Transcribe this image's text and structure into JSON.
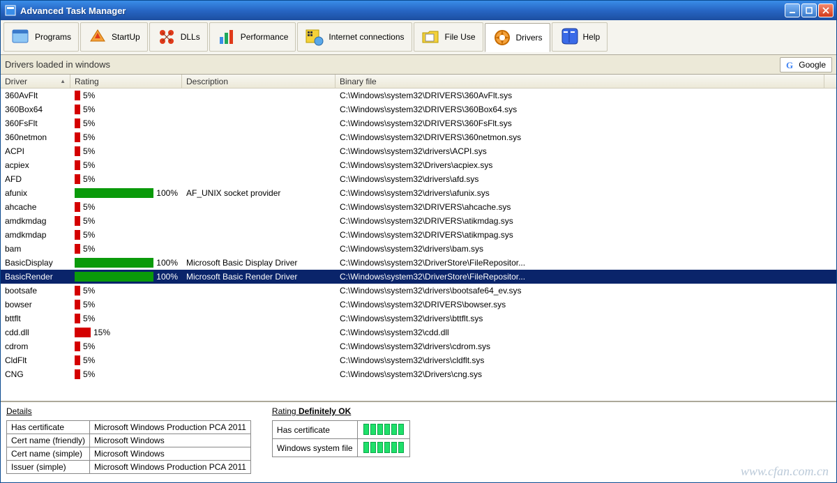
{
  "window": {
    "title": "Advanced Task Manager"
  },
  "tabs": [
    {
      "label": "Programs"
    },
    {
      "label": "StartUp"
    },
    {
      "label": "DLLs"
    },
    {
      "label": "Performance"
    },
    {
      "label": "Internet connections"
    },
    {
      "label": "File Use"
    },
    {
      "label": "Drivers"
    },
    {
      "label": "Help"
    }
  ],
  "subbar": {
    "title": "Drivers loaded in windows",
    "google_label": "Google"
  },
  "columns": {
    "driver": "Driver",
    "rating": "Rating",
    "description": "Description",
    "binary": "Binary file"
  },
  "rows": [
    {
      "driver": "360AvFlt",
      "rating": 5,
      "color": "red",
      "description": "",
      "binary": "C:\\Windows\\system32\\DRIVERS\\360AvFlt.sys"
    },
    {
      "driver": "360Box64",
      "rating": 5,
      "color": "red",
      "description": "",
      "binary": "C:\\Windows\\system32\\DRIVERS\\360Box64.sys"
    },
    {
      "driver": "360FsFlt",
      "rating": 5,
      "color": "red",
      "description": "",
      "binary": "C:\\Windows\\system32\\DRIVERS\\360FsFlt.sys"
    },
    {
      "driver": "360netmon",
      "rating": 5,
      "color": "red",
      "description": "",
      "binary": "C:\\Windows\\system32\\DRIVERS\\360netmon.sys"
    },
    {
      "driver": "ACPI",
      "rating": 5,
      "color": "red",
      "description": "",
      "binary": "C:\\Windows\\system32\\drivers\\ACPI.sys"
    },
    {
      "driver": "acpiex",
      "rating": 5,
      "color": "red",
      "description": "",
      "binary": "C:\\Windows\\system32\\Drivers\\acpiex.sys"
    },
    {
      "driver": "AFD",
      "rating": 5,
      "color": "red",
      "description": "",
      "binary": "C:\\Windows\\system32\\drivers\\afd.sys"
    },
    {
      "driver": "afunix",
      "rating": 100,
      "color": "green",
      "description": "AF_UNIX socket provider",
      "binary": "C:\\Windows\\system32\\drivers\\afunix.sys"
    },
    {
      "driver": "ahcache",
      "rating": 5,
      "color": "red",
      "description": "",
      "binary": "C:\\Windows\\system32\\DRIVERS\\ahcache.sys"
    },
    {
      "driver": "amdkmdag",
      "rating": 5,
      "color": "red",
      "description": "",
      "binary": "C:\\Windows\\system32\\DRIVERS\\atikmdag.sys"
    },
    {
      "driver": "amdkmdap",
      "rating": 5,
      "color": "red",
      "description": "",
      "binary": "C:\\Windows\\system32\\DRIVERS\\atikmpag.sys"
    },
    {
      "driver": "bam",
      "rating": 5,
      "color": "red",
      "description": "",
      "binary": "C:\\Windows\\system32\\drivers\\bam.sys"
    },
    {
      "driver": "BasicDisplay",
      "rating": 100,
      "color": "green",
      "description": "Microsoft Basic Display Driver",
      "binary": "C:\\Windows\\system32\\DriverStore\\FileRepositor..."
    },
    {
      "driver": "BasicRender",
      "rating": 100,
      "color": "green",
      "description": "Microsoft Basic Render Driver",
      "binary": "C:\\Windows\\system32\\DriverStore\\FileRepositor...",
      "selected": true
    },
    {
      "driver": "bootsafe",
      "rating": 5,
      "color": "red",
      "description": "",
      "binary": "C:\\Windows\\system32\\drivers\\bootsafe64_ev.sys"
    },
    {
      "driver": "bowser",
      "rating": 5,
      "color": "red",
      "description": "",
      "binary": "C:\\Windows\\system32\\DRIVERS\\bowser.sys"
    },
    {
      "driver": "bttflt",
      "rating": 5,
      "color": "red",
      "description": "",
      "binary": "C:\\Windows\\system32\\drivers\\bttflt.sys"
    },
    {
      "driver": "cdd.dll",
      "rating": 15,
      "color": "red",
      "description": "",
      "binary": "C:\\Windows\\system32\\cdd.dll"
    },
    {
      "driver": "cdrom",
      "rating": 5,
      "color": "red",
      "description": "",
      "binary": "C:\\Windows\\system32\\drivers\\cdrom.sys"
    },
    {
      "driver": "CldFlt",
      "rating": 5,
      "color": "red",
      "description": "",
      "binary": "C:\\Windows\\system32\\drivers\\cldflt.sys"
    },
    {
      "driver": "CNG",
      "rating": 5,
      "color": "red",
      "description": "",
      "binary": "C:\\Windows\\system32\\Drivers\\cng.sys"
    }
  ],
  "details": {
    "header": "Details",
    "rows": [
      {
        "k": "Has certificate",
        "v": "Microsoft Windows Production PCA 2011"
      },
      {
        "k": "Cert name (friendly)",
        "v": "Microsoft Windows"
      },
      {
        "k": "Cert name (simple)",
        "v": "Microsoft Windows"
      },
      {
        "k": "Issuer (simple)",
        "v": "Microsoft Windows Production PCA 2011"
      }
    ]
  },
  "rating_panel": {
    "header_prefix": "Rating",
    "header_value": "Definitely OK",
    "rows": [
      {
        "k": "Has certificate"
      },
      {
        "k": "Windows system file"
      }
    ]
  },
  "watermark": "www.cfan.com.cn"
}
